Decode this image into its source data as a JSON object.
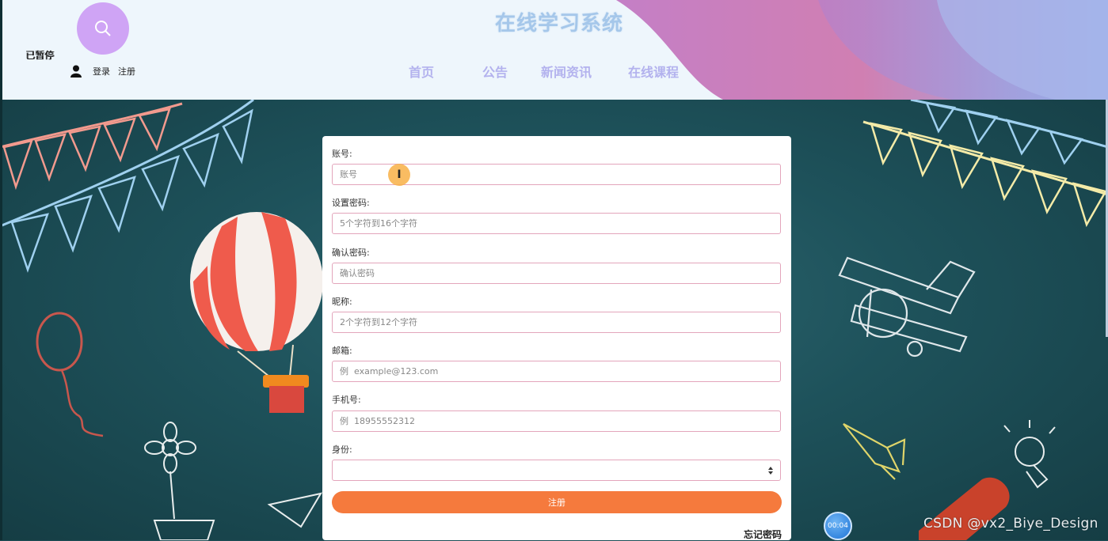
{
  "header": {
    "site_title": "在线学习系统",
    "paused_label": "已暂停",
    "login_label": "登录",
    "register_label": "注册",
    "nav": [
      "首页",
      "公告",
      "新闻资讯",
      "在线课程"
    ]
  },
  "form": {
    "fields": [
      {
        "label": "账号:",
        "placeholder": "账号"
      },
      {
        "label": "设置密码:",
        "placeholder": "5个字符到16个字符"
      },
      {
        "label": "确认密码:",
        "placeholder": "确认密码"
      },
      {
        "label": "昵称:",
        "placeholder": "2个字符到12个字符"
      },
      {
        "label": "邮箱:",
        "placeholder": "例  example@123.com"
      },
      {
        "label": "手机号:",
        "placeholder": "例  18955552312"
      }
    ],
    "role_label": "身份:",
    "role_value": "",
    "submit_label": "注册",
    "forgot_label": "忘记密码"
  },
  "overlay": {
    "cursor_glyph": "I",
    "timer": "00:04",
    "watermark": "CSDN @vx2_Biye_Design"
  },
  "colors": {
    "accent_button": "#f57a3d",
    "input_border": "#e3a5bb",
    "title": "#a5c7ea",
    "nav": "#b3b2ee",
    "search_circle": "#cfa4f5"
  }
}
